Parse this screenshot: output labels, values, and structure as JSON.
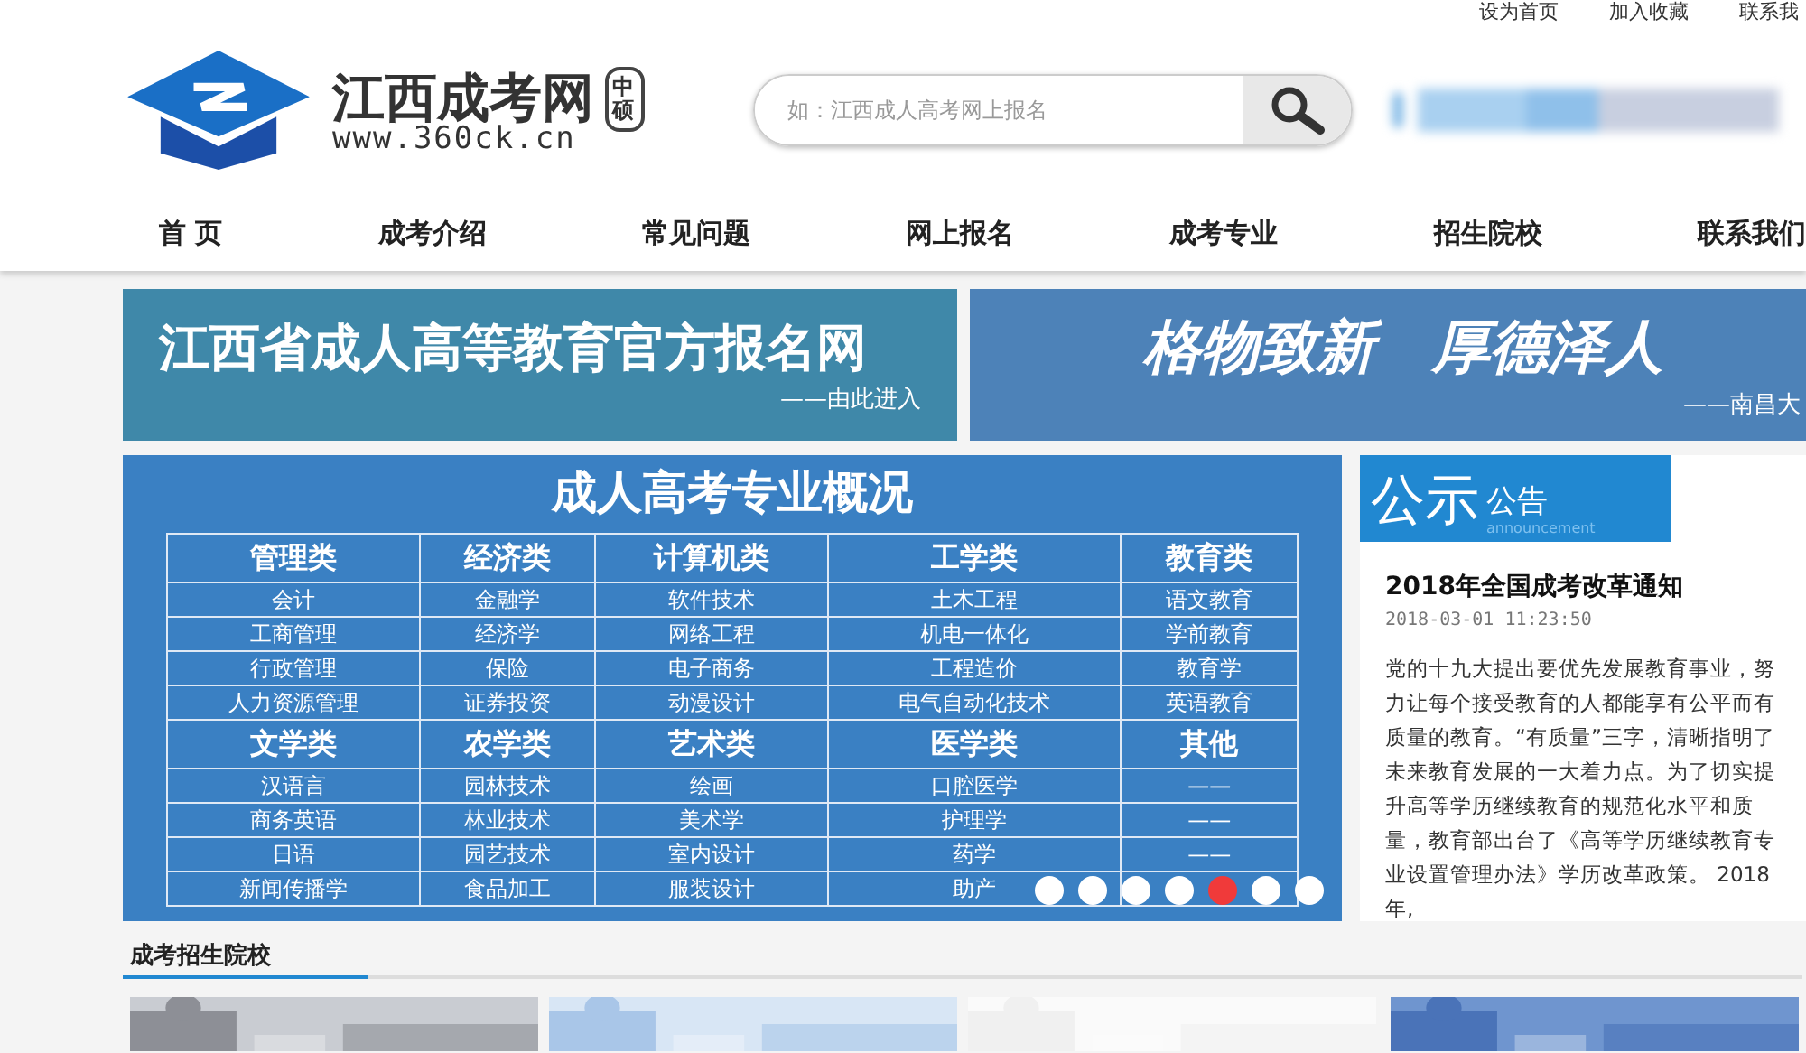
{
  "top_links": [
    "设为首页",
    "加入收藏",
    "联系我"
  ],
  "logo": {
    "title": "江西成考网",
    "badge": "中硕",
    "url": "www.360ck.cn"
  },
  "search": {
    "placeholder": "如：江西成人高考网上报名"
  },
  "nav": [
    "首 页",
    "成考介绍",
    "常见问题",
    "网上报名",
    "成考专业",
    "招生院校",
    "联系我们"
  ],
  "banners": [
    {
      "title": "江西省成人高等教育官方报名网",
      "subtitle": "——由此进入"
    },
    {
      "title": "格物致新　厚德泽人",
      "subtitle": "——南昌大"
    }
  ],
  "slide": {
    "title": "成人高考专业概况",
    "groups": [
      {
        "headers": [
          "管理类",
          "经济类",
          "计算机类",
          "工学类",
          "教育类"
        ],
        "rows": [
          [
            "会计",
            "金融学",
            "软件技术",
            "土木工程",
            "语文教育"
          ],
          [
            "工商管理",
            "经济学",
            "网络工程",
            "机电一体化",
            "学前教育"
          ],
          [
            "行政管理",
            "保险",
            "电子商务",
            "工程造价",
            "教育学"
          ],
          [
            "人力资源管理",
            "证券投资",
            "动漫设计",
            "电气自动化技术",
            "英语教育"
          ]
        ]
      },
      {
        "headers": [
          "文学类",
          "农学类",
          "艺术类",
          "医学类",
          "其他"
        ],
        "rows": [
          [
            "汉语言",
            "园林技术",
            "绘画",
            "口腔医学",
            "——"
          ],
          [
            "商务英语",
            "林业技术",
            "美术学",
            "护理学",
            "——"
          ],
          [
            "日语",
            "园艺技术",
            "室内设计",
            "药学",
            "——"
          ],
          [
            "新闻传播学",
            "食品加工",
            "服装设计",
            "助产"
          ]
        ]
      }
    ],
    "dots": [
      {
        "selected": false
      },
      {
        "selected": false
      },
      {
        "selected": false
      },
      {
        "selected": false
      },
      {
        "selected": true
      },
      {
        "selected": false
      },
      {
        "selected": false
      }
    ]
  },
  "notice": {
    "big": "公示",
    "small": "公告",
    "en": "announcement",
    "title": "2018年全国成考改革通知",
    "time": "2018-03-01  11:23:50",
    "body": "党的十九大提出要优先发展教育事业，努力让每个接受教育的人都能享有公平而有质量的教育。“有质量”三字，清晰指明了未来教育发展的一大着力点。为了切实提升高等学历继续教育的规范化水平和质量，教育部出台了《高等学历继续教育专业设置管理办法》学历改革政策。 2018年,"
  },
  "schools": {
    "title": "成考招生院校"
  }
}
